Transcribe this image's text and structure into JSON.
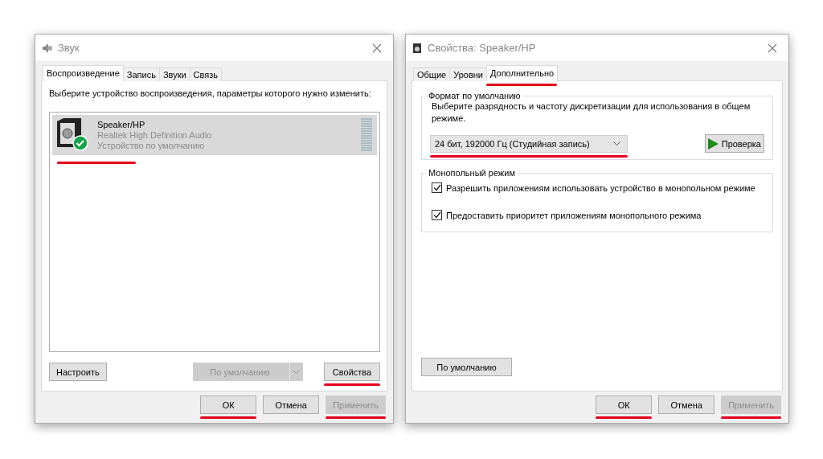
{
  "sound_window": {
    "title": "Звук",
    "tabs": [
      {
        "label": "Воспроизведение",
        "selected": true
      },
      {
        "label": "Запись",
        "selected": false
      },
      {
        "label": "Звуки",
        "selected": false
      },
      {
        "label": "Связь",
        "selected": false
      }
    ],
    "instruction": "Выберите устройство воспроизведения, параметры которого нужно изменить:",
    "devices": [
      {
        "name": "Speaker/HP",
        "driver": "Realtek High Definition Audio",
        "status": "Устройство по умолчанию",
        "is_default": true,
        "selected": true,
        "underlined": true
      }
    ],
    "panel_buttons": [
      {
        "kind": "plain",
        "label": "Настроить",
        "disabled": false,
        "underlined": false
      },
      {
        "kind": "split",
        "label": "По умолчанию",
        "disabled": true,
        "underlined": false
      },
      {
        "kind": "plain",
        "label": "Свойства",
        "disabled": false,
        "underlined": true
      }
    ],
    "buttons": [
      {
        "label": "ОК",
        "disabled": false,
        "underlined": true
      },
      {
        "label": "Отмена",
        "disabled": false,
        "underlined": false
      },
      {
        "label": "Применить",
        "disabled": true,
        "underlined": true
      }
    ]
  },
  "properties_window": {
    "title": "Свойства: Speaker/HP",
    "tabs": [
      {
        "label": "Общие",
        "selected": false,
        "underlined": false
      },
      {
        "label": "Уровни",
        "selected": false,
        "underlined": false
      },
      {
        "label": "Дополнительно",
        "selected": true,
        "underlined": true
      }
    ],
    "format_group": {
      "title": "Формат по умолчанию",
      "description": "Выберите разрядность и частоту дискретизации для использования в общем режиме.",
      "format_value": "24 бит, 192000 Гц (Студийная запись)",
      "format_underlined": true,
      "test_button": "Проверка"
    },
    "exclusive_group": {
      "title": "Монопольный режим",
      "options": [
        {
          "label": "Разрешить приложениям использовать устройство в монопольном режиме",
          "checked": true
        },
        {
          "label": "Предоставить приоритет приложениям монопольного режима",
          "checked": true
        }
      ]
    },
    "restore_button": "По умолчанию",
    "buttons": [
      {
        "label": "ОК",
        "disabled": false,
        "underlined": true
      },
      {
        "label": "Отмена",
        "disabled": false,
        "underlined": false
      },
      {
        "label": "Применить",
        "disabled": true,
        "underlined": true
      }
    ]
  }
}
